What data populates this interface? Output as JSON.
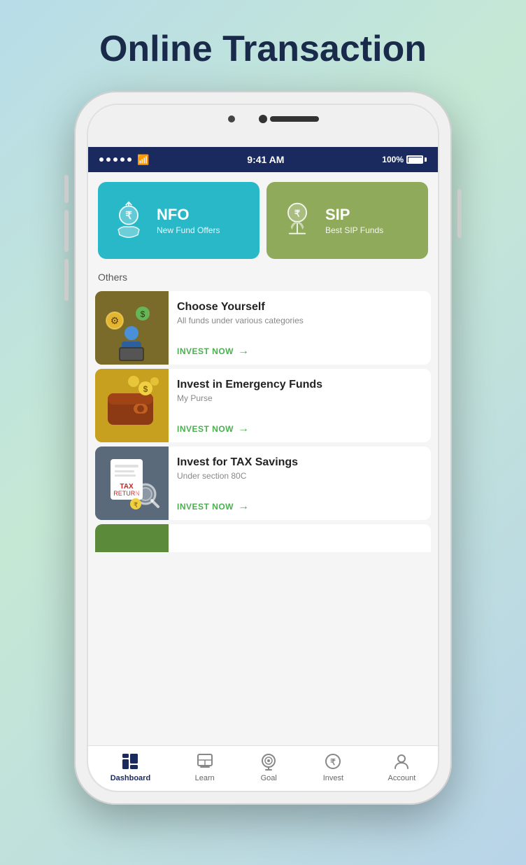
{
  "page": {
    "title": "Online Transaction",
    "background_gradient": "linear-gradient(135deg, #b8dce8 0%, #c5e8d5 40%, #b8d4e8 100%)"
  },
  "status_bar": {
    "time": "9:41 AM",
    "battery": "100%"
  },
  "cards": [
    {
      "id": "nfo",
      "title": "NFO",
      "subtitle": "New Fund Offers",
      "color": "#29b8c8"
    },
    {
      "id": "sip",
      "title": "SIP",
      "subtitle": "Best SIP Funds",
      "color": "#8faa5a"
    }
  ],
  "others_label": "Others",
  "list_items": [
    {
      "id": "choose-yourself",
      "title": "Choose Yourself",
      "subtitle": "All funds under various categories",
      "cta": "INVEST NOW",
      "thumb_color": "#7b6b2a"
    },
    {
      "id": "emergency-funds",
      "title": "Invest in Emergency Funds",
      "subtitle": "My Purse",
      "cta": "INVEST NOW",
      "thumb_color": "#c8a020"
    },
    {
      "id": "tax-savings",
      "title": "Invest for TAX Savings",
      "subtitle": "Under section 80C",
      "cta": "INVEST NOW",
      "thumb_color": "#5a6a7a"
    }
  ],
  "bottom_nav": [
    {
      "id": "dashboard",
      "label": "Dashboard",
      "active": true
    },
    {
      "id": "learn",
      "label": "Learn",
      "active": false
    },
    {
      "id": "goal",
      "label": "Goal",
      "active": false
    },
    {
      "id": "invest",
      "label": "Invest",
      "active": false
    },
    {
      "id": "account",
      "label": "Account",
      "active": false
    }
  ]
}
